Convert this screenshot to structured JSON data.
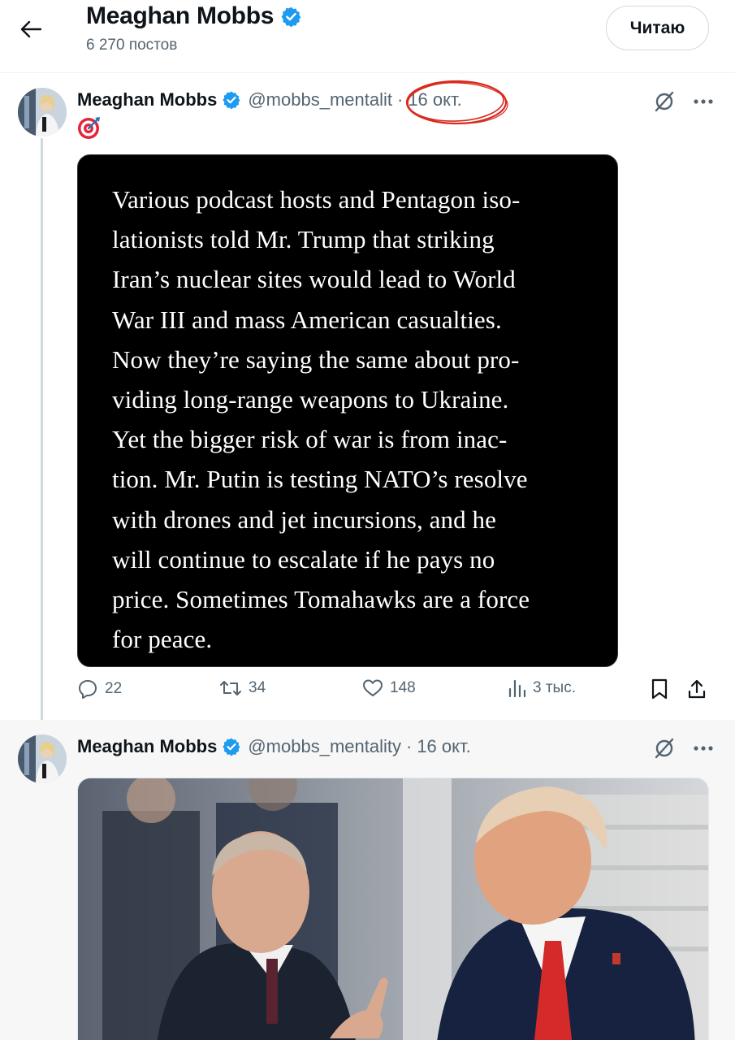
{
  "header": {
    "title": "Meaghan Mobbs",
    "post_count": "6 270 постов",
    "follow_label": "Читаю"
  },
  "tweets": [
    {
      "name": "Meaghan Mobbs",
      "handle": "@mobbs_mentalit",
      "dot": "·",
      "date": "16 окт.",
      "emoji": "direct-hit-target-emoji",
      "quote_lines": [
        "Various podcast hosts and Pentagon iso-",
        "lationists told Mr. Trump that striking",
        "Iran’s nuclear sites would lead to World",
        "War III and mass American casualties.",
        "Now they’re saying the same about pro-",
        "viding long-range weapons to Ukraine.",
        "Yet the bigger risk of war is from inac-",
        "tion. Mr. Putin is testing NATO’s resolve",
        "with drones and jet incursions, and he",
        "will continue to escalate if he pays no",
        "price. Sometimes Tomahawks are a force",
        "for peace."
      ],
      "actions": {
        "replies": "22",
        "reposts": "34",
        "likes": "148",
        "views": "3 тыс."
      }
    },
    {
      "name": "Meaghan Mobbs",
      "handle": "@mobbs_mentality",
      "dot": "·",
      "date": "16 окт."
    }
  ],
  "colors": {
    "verified_blue": "#1d9bf0",
    "secondary_text": "#536471",
    "annotation_red": "#d92b1f"
  }
}
